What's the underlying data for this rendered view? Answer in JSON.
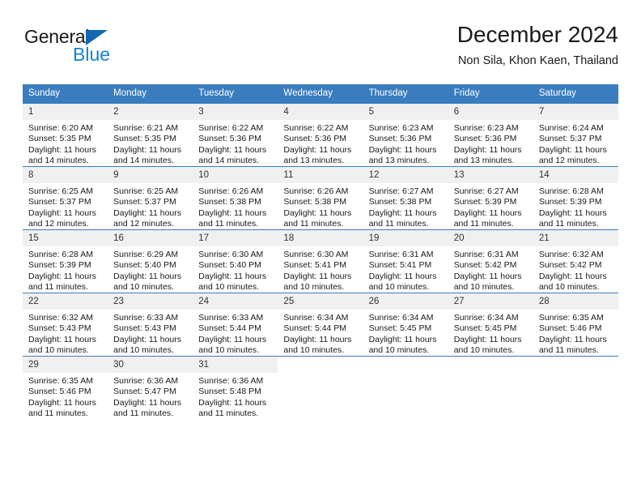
{
  "brand": {
    "name_top": "General",
    "name_bottom": "Blue",
    "accent_dark": "#1268b3",
    "accent_light": "#1184d4"
  },
  "header": {
    "title": "December 2024",
    "subtitle": "Non Sila, Khon Kaen, Thailand"
  },
  "calendar": {
    "header_bg": "#3a7dbf",
    "daynum_bg": "#f0f0f0",
    "weekdays": [
      "Sunday",
      "Monday",
      "Tuesday",
      "Wednesday",
      "Thursday",
      "Friday",
      "Saturday"
    ],
    "weeks": [
      [
        {
          "day": "1",
          "sunrise": "Sunrise: 6:20 AM",
          "sunset": "Sunset: 5:35 PM",
          "daylight1": "Daylight: 11 hours",
          "daylight2": "and 14 minutes."
        },
        {
          "day": "2",
          "sunrise": "Sunrise: 6:21 AM",
          "sunset": "Sunset: 5:35 PM",
          "daylight1": "Daylight: 11 hours",
          "daylight2": "and 14 minutes."
        },
        {
          "day": "3",
          "sunrise": "Sunrise: 6:22 AM",
          "sunset": "Sunset: 5:36 PM",
          "daylight1": "Daylight: 11 hours",
          "daylight2": "and 14 minutes."
        },
        {
          "day": "4",
          "sunrise": "Sunrise: 6:22 AM",
          "sunset": "Sunset: 5:36 PM",
          "daylight1": "Daylight: 11 hours",
          "daylight2": "and 13 minutes."
        },
        {
          "day": "5",
          "sunrise": "Sunrise: 6:23 AM",
          "sunset": "Sunset: 5:36 PM",
          "daylight1": "Daylight: 11 hours",
          "daylight2": "and 13 minutes."
        },
        {
          "day": "6",
          "sunrise": "Sunrise: 6:23 AM",
          "sunset": "Sunset: 5:36 PM",
          "daylight1": "Daylight: 11 hours",
          "daylight2": "and 13 minutes."
        },
        {
          "day": "7",
          "sunrise": "Sunrise: 6:24 AM",
          "sunset": "Sunset: 5:37 PM",
          "daylight1": "Daylight: 11 hours",
          "daylight2": "and 12 minutes."
        }
      ],
      [
        {
          "day": "8",
          "sunrise": "Sunrise: 6:25 AM",
          "sunset": "Sunset: 5:37 PM",
          "daylight1": "Daylight: 11 hours",
          "daylight2": "and 12 minutes."
        },
        {
          "day": "9",
          "sunrise": "Sunrise: 6:25 AM",
          "sunset": "Sunset: 5:37 PM",
          "daylight1": "Daylight: 11 hours",
          "daylight2": "and 12 minutes."
        },
        {
          "day": "10",
          "sunrise": "Sunrise: 6:26 AM",
          "sunset": "Sunset: 5:38 PM",
          "daylight1": "Daylight: 11 hours",
          "daylight2": "and 11 minutes."
        },
        {
          "day": "11",
          "sunrise": "Sunrise: 6:26 AM",
          "sunset": "Sunset: 5:38 PM",
          "daylight1": "Daylight: 11 hours",
          "daylight2": "and 11 minutes."
        },
        {
          "day": "12",
          "sunrise": "Sunrise: 6:27 AM",
          "sunset": "Sunset: 5:38 PM",
          "daylight1": "Daylight: 11 hours",
          "daylight2": "and 11 minutes."
        },
        {
          "day": "13",
          "sunrise": "Sunrise: 6:27 AM",
          "sunset": "Sunset: 5:39 PM",
          "daylight1": "Daylight: 11 hours",
          "daylight2": "and 11 minutes."
        },
        {
          "day": "14",
          "sunrise": "Sunrise: 6:28 AM",
          "sunset": "Sunset: 5:39 PM",
          "daylight1": "Daylight: 11 hours",
          "daylight2": "and 11 minutes."
        }
      ],
      [
        {
          "day": "15",
          "sunrise": "Sunrise: 6:28 AM",
          "sunset": "Sunset: 5:39 PM",
          "daylight1": "Daylight: 11 hours",
          "daylight2": "and 11 minutes."
        },
        {
          "day": "16",
          "sunrise": "Sunrise: 6:29 AM",
          "sunset": "Sunset: 5:40 PM",
          "daylight1": "Daylight: 11 hours",
          "daylight2": "and 10 minutes."
        },
        {
          "day": "17",
          "sunrise": "Sunrise: 6:30 AM",
          "sunset": "Sunset: 5:40 PM",
          "daylight1": "Daylight: 11 hours",
          "daylight2": "and 10 minutes."
        },
        {
          "day": "18",
          "sunrise": "Sunrise: 6:30 AM",
          "sunset": "Sunset: 5:41 PM",
          "daylight1": "Daylight: 11 hours",
          "daylight2": "and 10 minutes."
        },
        {
          "day": "19",
          "sunrise": "Sunrise: 6:31 AM",
          "sunset": "Sunset: 5:41 PM",
          "daylight1": "Daylight: 11 hours",
          "daylight2": "and 10 minutes."
        },
        {
          "day": "20",
          "sunrise": "Sunrise: 6:31 AM",
          "sunset": "Sunset: 5:42 PM",
          "daylight1": "Daylight: 11 hours",
          "daylight2": "and 10 minutes."
        },
        {
          "day": "21",
          "sunrise": "Sunrise: 6:32 AM",
          "sunset": "Sunset: 5:42 PM",
          "daylight1": "Daylight: 11 hours",
          "daylight2": "and 10 minutes."
        }
      ],
      [
        {
          "day": "22",
          "sunrise": "Sunrise: 6:32 AM",
          "sunset": "Sunset: 5:43 PM",
          "daylight1": "Daylight: 11 hours",
          "daylight2": "and 10 minutes."
        },
        {
          "day": "23",
          "sunrise": "Sunrise: 6:33 AM",
          "sunset": "Sunset: 5:43 PM",
          "daylight1": "Daylight: 11 hours",
          "daylight2": "and 10 minutes."
        },
        {
          "day": "24",
          "sunrise": "Sunrise: 6:33 AM",
          "sunset": "Sunset: 5:44 PM",
          "daylight1": "Daylight: 11 hours",
          "daylight2": "and 10 minutes."
        },
        {
          "day": "25",
          "sunrise": "Sunrise: 6:34 AM",
          "sunset": "Sunset: 5:44 PM",
          "daylight1": "Daylight: 11 hours",
          "daylight2": "and 10 minutes."
        },
        {
          "day": "26",
          "sunrise": "Sunrise: 6:34 AM",
          "sunset": "Sunset: 5:45 PM",
          "daylight1": "Daylight: 11 hours",
          "daylight2": "and 10 minutes."
        },
        {
          "day": "27",
          "sunrise": "Sunrise: 6:34 AM",
          "sunset": "Sunset: 5:45 PM",
          "daylight1": "Daylight: 11 hours",
          "daylight2": "and 10 minutes."
        },
        {
          "day": "28",
          "sunrise": "Sunrise: 6:35 AM",
          "sunset": "Sunset: 5:46 PM",
          "daylight1": "Daylight: 11 hours",
          "daylight2": "and 11 minutes."
        }
      ],
      [
        {
          "day": "29",
          "sunrise": "Sunrise: 6:35 AM",
          "sunset": "Sunset: 5:46 PM",
          "daylight1": "Daylight: 11 hours",
          "daylight2": "and 11 minutes."
        },
        {
          "day": "30",
          "sunrise": "Sunrise: 6:36 AM",
          "sunset": "Sunset: 5:47 PM",
          "daylight1": "Daylight: 11 hours",
          "daylight2": "and 11 minutes."
        },
        {
          "day": "31",
          "sunrise": "Sunrise: 6:36 AM",
          "sunset": "Sunset: 5:48 PM",
          "daylight1": "Daylight: 11 hours",
          "daylight2": "and 11 minutes."
        },
        {
          "day": "",
          "sunrise": "",
          "sunset": "",
          "daylight1": "",
          "daylight2": ""
        },
        {
          "day": "",
          "sunrise": "",
          "sunset": "",
          "daylight1": "",
          "daylight2": ""
        },
        {
          "day": "",
          "sunrise": "",
          "sunset": "",
          "daylight1": "",
          "daylight2": ""
        },
        {
          "day": "",
          "sunrise": "",
          "sunset": "",
          "daylight1": "",
          "daylight2": ""
        }
      ]
    ]
  }
}
